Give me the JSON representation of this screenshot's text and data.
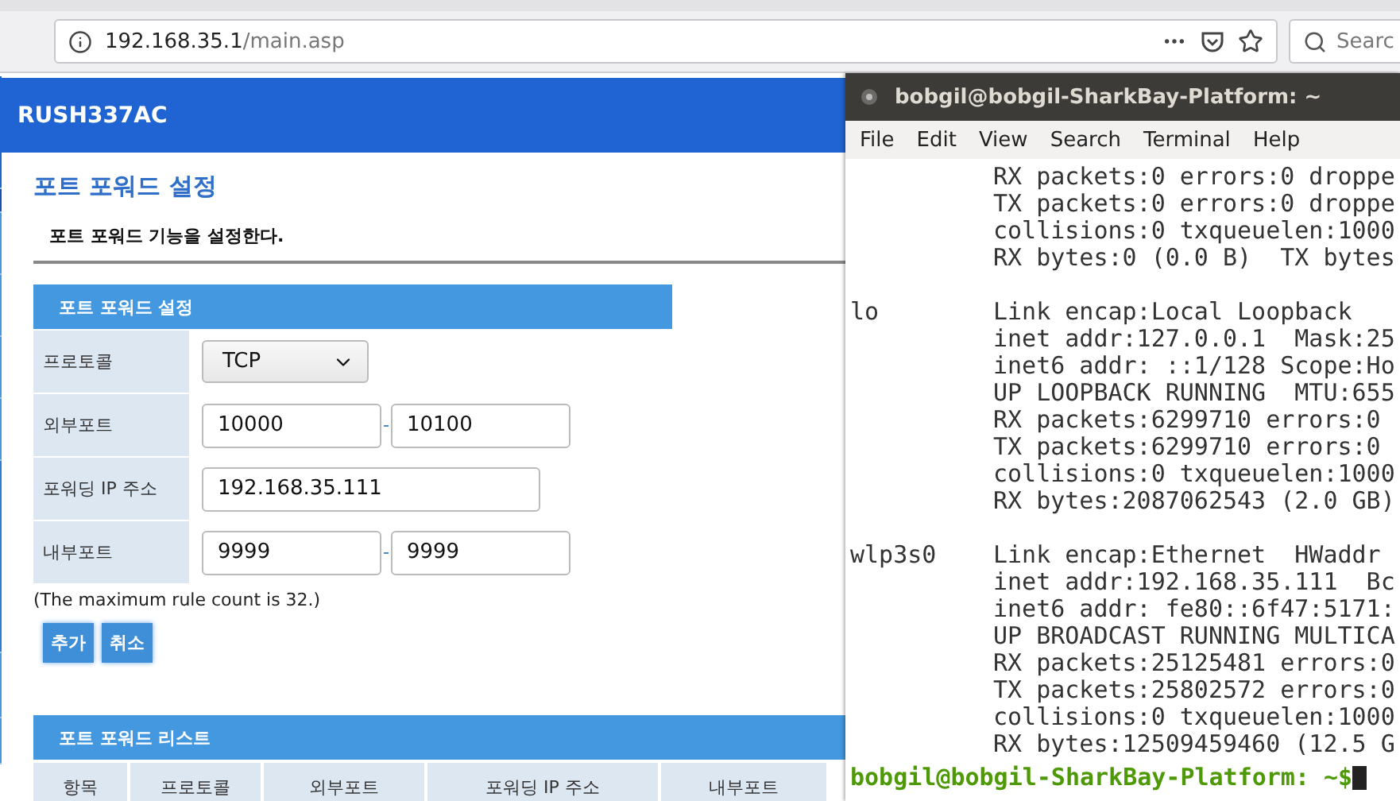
{
  "browser": {
    "address_host": "192.168.35.1",
    "address_path": "/main.asp",
    "search_placeholder": "Searc"
  },
  "router": {
    "brand": "RUSH337AC",
    "page_title": "포트 포워드 설정",
    "description": "포트 포워드 기능을 설정한다.",
    "form": {
      "title": "포트 포워드 설정",
      "rows": [
        {
          "kind": "select",
          "label": "프로토콜",
          "value": "TCP"
        },
        {
          "kind": "range",
          "label": "외부포트",
          "from": "10000",
          "separator": "-",
          "to": "10100"
        },
        {
          "kind": "text",
          "label": "포워딩 IP 주소",
          "value": "192.168.35.111"
        },
        {
          "kind": "range",
          "label": "내부포트",
          "from": "9999",
          "separator": "-",
          "to": "9999"
        }
      ],
      "note": "(The maximum rule count is 32.)",
      "buttons": [
        "추가",
        "취소"
      ]
    },
    "list": {
      "title": "포트 포워드 리스트",
      "columns": [
        "항목",
        "프로토콜",
        "외부포트",
        "포워딩 IP 주소",
        "내부포트"
      ]
    }
  },
  "terminal": {
    "title": "bobgil@bobgil-SharkBay-Platform: ~",
    "menu": [
      "File",
      "Edit",
      "View",
      "Search",
      "Terminal",
      "Help"
    ],
    "lines": [
      {
        "kind": "output",
        "text": "RX packets:0 errors:0 droppe"
      },
      {
        "kind": "output",
        "text": "TX packets:0 errors:0 droppe"
      },
      {
        "kind": "output",
        "text": "collisions:0 txqueuelen:1000"
      },
      {
        "kind": "output",
        "text": "RX bytes:0 (0.0 B)  TX bytes"
      },
      {
        "kind": "blank"
      },
      {
        "kind": "output",
        "iface": "lo",
        "text": "Link encap:Local Loopback"
      },
      {
        "kind": "output",
        "text": "inet addr:127.0.0.1  Mask:25"
      },
      {
        "kind": "output",
        "text": "inet6 addr: ::1/128 Scope:Ho"
      },
      {
        "kind": "output",
        "text": "UP LOOPBACK RUNNING  MTU:655"
      },
      {
        "kind": "output",
        "text": "RX packets:6299710 errors:0"
      },
      {
        "kind": "output",
        "text": "TX packets:6299710 errors:0"
      },
      {
        "kind": "output",
        "text": "collisions:0 txqueuelen:1000"
      },
      {
        "kind": "output",
        "text": "RX bytes:2087062543 (2.0 GB)"
      },
      {
        "kind": "blank"
      },
      {
        "kind": "output",
        "iface": "wlp3s0",
        "text": "Link encap:Ethernet  HWaddr"
      },
      {
        "kind": "output",
        "text": "inet addr:192.168.35.111  Bc"
      },
      {
        "kind": "output",
        "text": "inet6 addr: fe80::6f47:5171:"
      },
      {
        "kind": "output",
        "text": "UP BROADCAST RUNNING MULTICA"
      },
      {
        "kind": "output",
        "text": "RX packets:25125481 errors:0"
      },
      {
        "kind": "output",
        "text": "TX packets:25802572 errors:0"
      },
      {
        "kind": "output",
        "text": "collisions:0 txqueuelen:1000"
      },
      {
        "kind": "output",
        "text": "RX bytes:12509459460 (12.5 G"
      }
    ],
    "prompt": "bobgil@bobgil-SharkBay-Platform: ~$"
  }
}
